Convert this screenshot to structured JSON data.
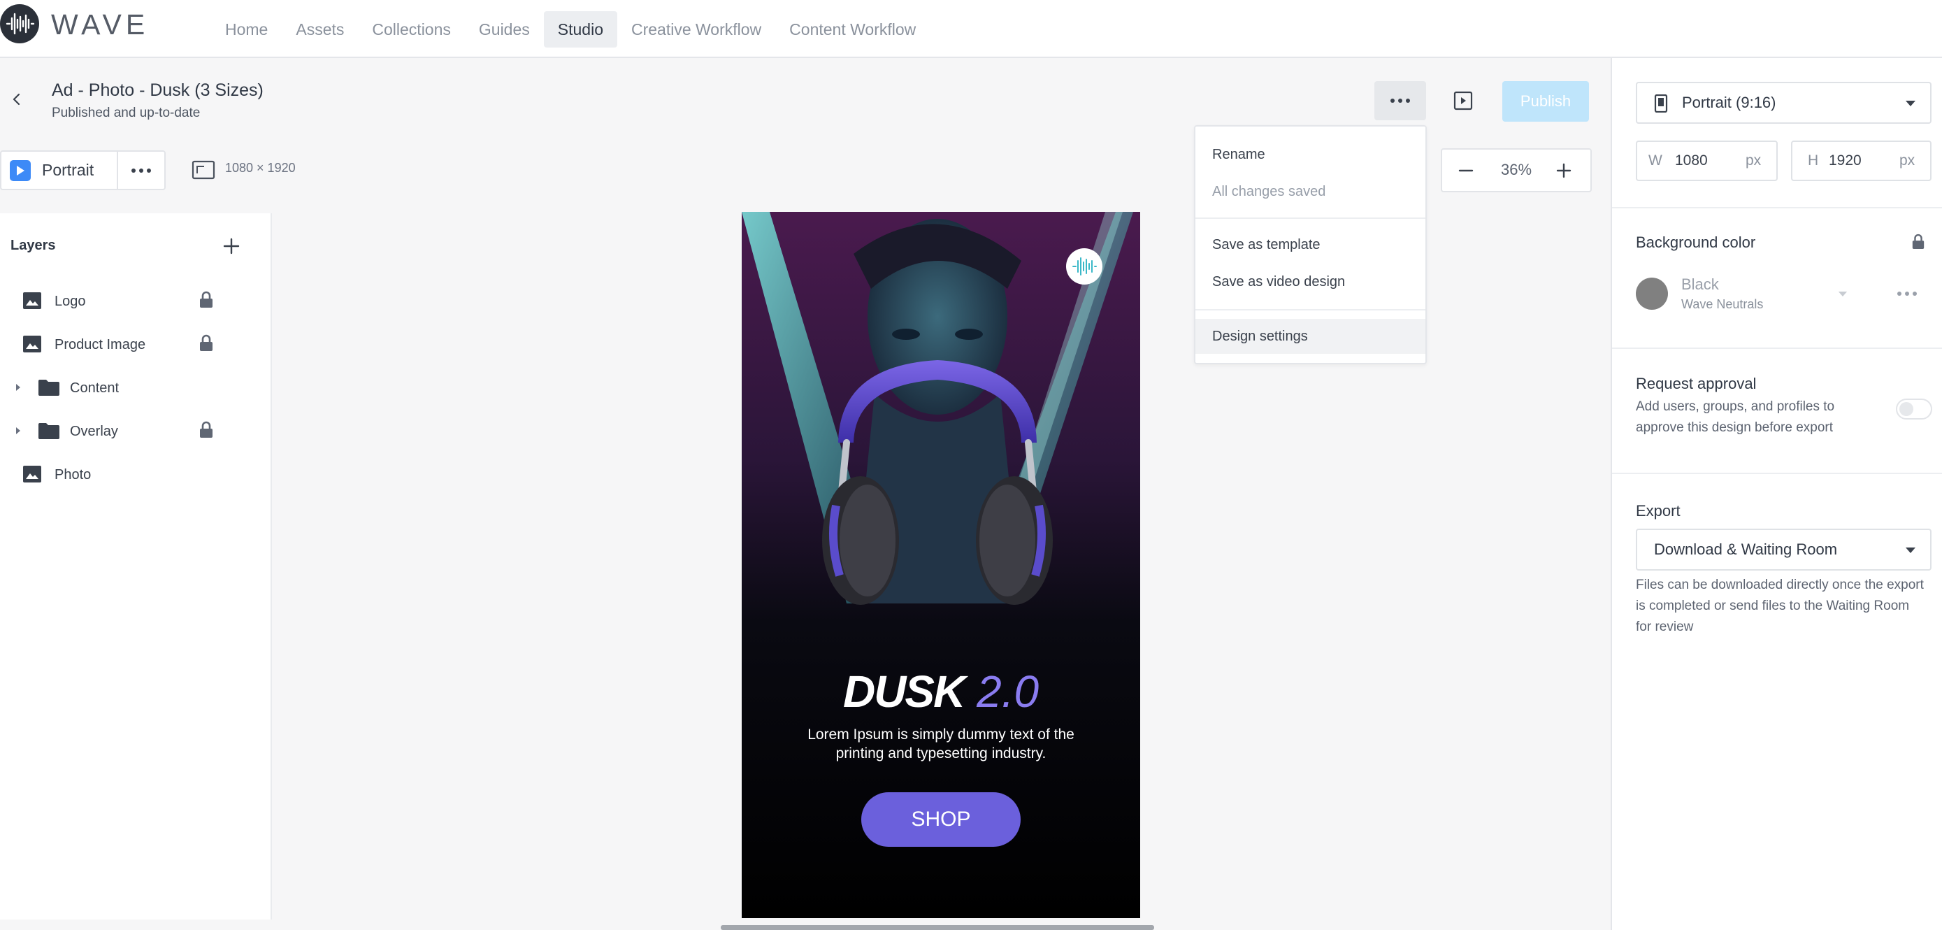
{
  "brand": {
    "name": "WAVE"
  },
  "nav": {
    "items": [
      "Home",
      "Assets",
      "Collections",
      "Guides",
      "Studio",
      "Creative Workflow",
      "Content Workflow"
    ],
    "active": "Studio"
  },
  "design": {
    "title": "Ad - Photo - Dusk (3 Sizes)",
    "status": "Published and up-to-date"
  },
  "toolbar": {
    "publish_label": "Publish"
  },
  "format": {
    "label": "Portrait",
    "dimensions": "1080 × 1920"
  },
  "layers": {
    "title": "Layers",
    "items": [
      {
        "label": "Logo",
        "icon": "image-icon",
        "locked": true,
        "expandable": false
      },
      {
        "label": "Product Image",
        "icon": "image-icon",
        "locked": true,
        "expandable": false
      },
      {
        "label": "Content",
        "icon": "folder-icon",
        "locked": false,
        "expandable": true
      },
      {
        "label": "Overlay",
        "icon": "folder-icon",
        "locked": true,
        "expandable": true
      },
      {
        "label": "Photo",
        "icon": "image-icon",
        "locked": false,
        "expandable": false
      }
    ]
  },
  "menu": {
    "rename": "Rename",
    "saved": "All changes saved",
    "save_template": "Save as template",
    "save_video": "Save as video design",
    "design_settings": "Design settings"
  },
  "zoom": {
    "value": "36%"
  },
  "ad": {
    "headline_bold": "DUSK",
    "headline_light": "2.0",
    "body_line1": "Lorem Ipsum is simply dummy text of the",
    "body_line2": "printing and typesetting industry.",
    "cta": "SHOP"
  },
  "properties": {
    "size_option": "Portrait (9:16)",
    "width_label": "W",
    "width_value": "1080",
    "width_unit": "px",
    "height_label": "H",
    "height_value": "1920",
    "height_unit": "px",
    "bg_title": "Background color",
    "bg_color_name": "Black",
    "bg_color_group": "Wave Neutrals",
    "approval_title": "Request approval",
    "approval_desc_1": "Add users, groups, and profiles to",
    "approval_desc_2": "approve this design before export",
    "approval_enabled": false,
    "export_title": "Export",
    "export_option": "Download & Waiting Room",
    "export_desc_1": "Files can be downloaded directly once the export",
    "export_desc_2": "is completed or send files to the Waiting Room",
    "export_desc_3": "for review"
  },
  "colors": {
    "accent": "#3d8af7",
    "publish_disabled": "#bfe5fb",
    "cta": "#6b60dc",
    "headline_accent": "#8a7cf0",
    "swatch": "#808080"
  }
}
